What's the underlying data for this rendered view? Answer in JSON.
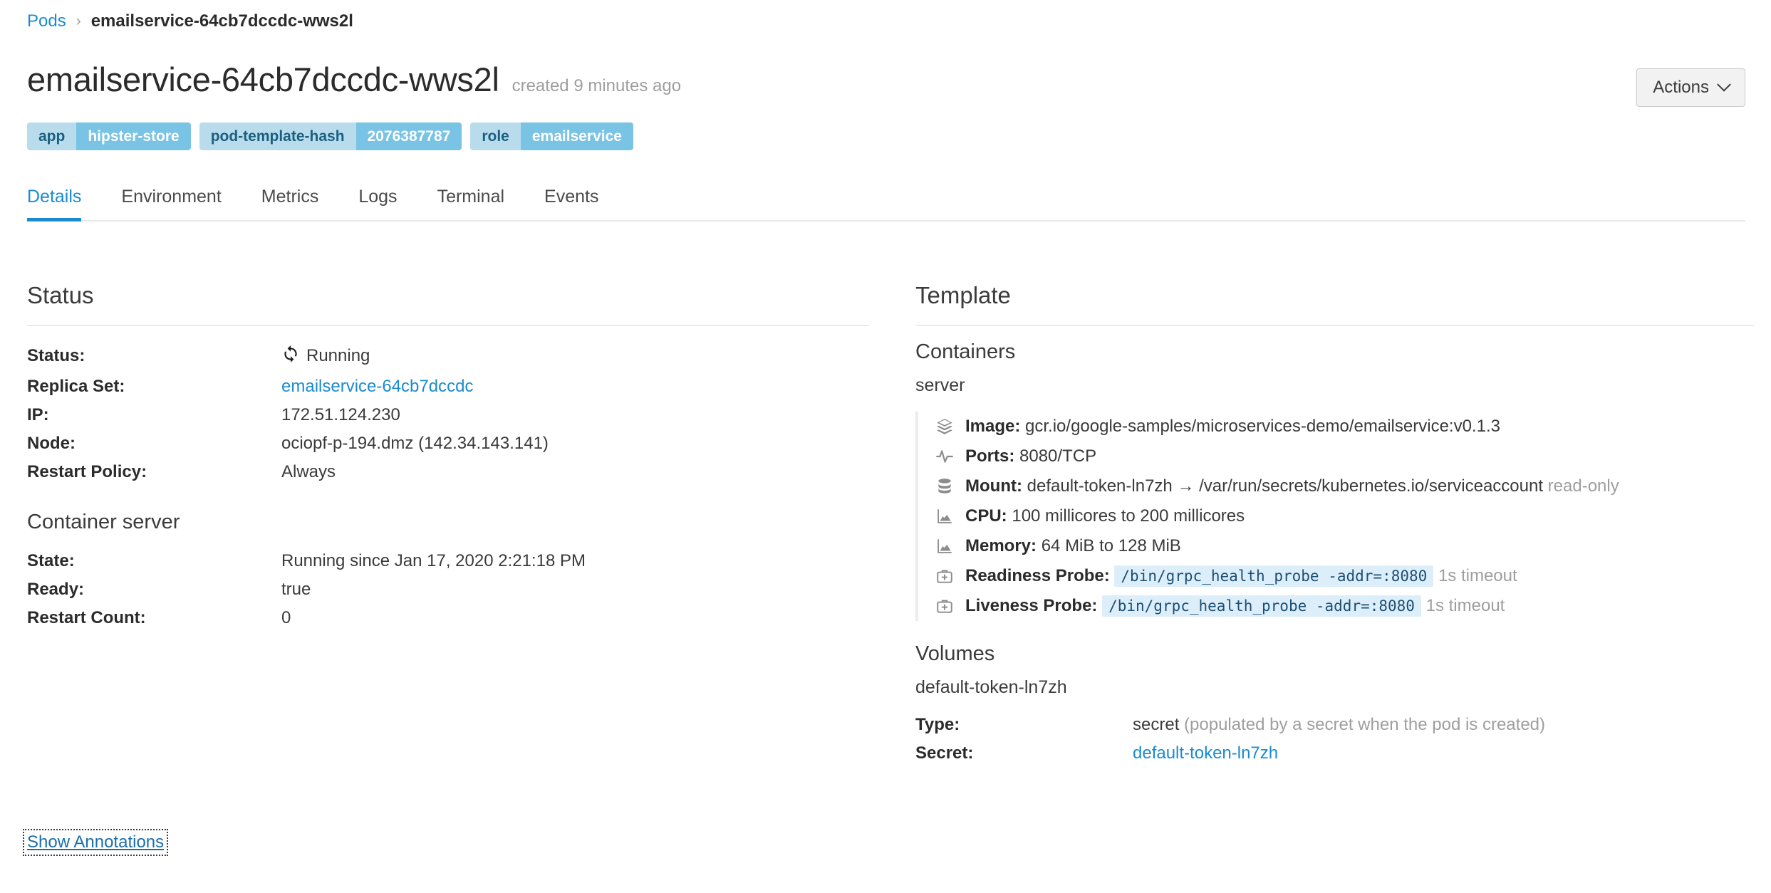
{
  "breadcrumb": {
    "parent": "Pods",
    "separator": "›",
    "current": "emailservice-64cb7dccdc-wws2l"
  },
  "header": {
    "title": "emailservice-64cb7dccdc-wws2l",
    "subtitle": "created 9 minutes ago",
    "actions_label": "Actions",
    "actions_icon": "chevron-down-icon"
  },
  "labels": [
    {
      "key": "app",
      "value": "hipster-store"
    },
    {
      "key": "pod-template-hash",
      "value": "2076387787"
    },
    {
      "key": "role",
      "value": "emailservice"
    }
  ],
  "tabs": [
    {
      "label": "Details",
      "active": true
    },
    {
      "label": "Environment",
      "active": false
    },
    {
      "label": "Metrics",
      "active": false
    },
    {
      "label": "Logs",
      "active": false
    },
    {
      "label": "Terminal",
      "active": false
    },
    {
      "label": "Events",
      "active": false
    }
  ],
  "status_section": {
    "title": "Status",
    "rows": [
      {
        "key": "Status:",
        "value": "Running",
        "icon": "sync-icon",
        "kind": "status"
      },
      {
        "key": "Replica Set:",
        "value": "emailservice-64cb7dccdc",
        "kind": "link"
      },
      {
        "key": "IP:",
        "value": "172.51.124.230",
        "kind": "text"
      },
      {
        "key": "Node:",
        "value": "ociopf-p-194.dmz (142.34.143.141)",
        "kind": "text"
      },
      {
        "key": "Restart Policy:",
        "value": "Always",
        "kind": "text"
      }
    ]
  },
  "container_status": {
    "title": "Container server",
    "rows": [
      {
        "key": "State:",
        "value": "Running since Jan 17, 2020 2:21:18 PM"
      },
      {
        "key": "Ready:",
        "value": "true"
      },
      {
        "key": "Restart Count:",
        "value": "0"
      }
    ]
  },
  "template_section": {
    "title": "Template",
    "containers_title": "Containers",
    "container_name": "server",
    "rows": [
      {
        "icon": "layers-icon",
        "label": "Image:",
        "value": "gcr.io/google-samples/microservices-demo/emailservice:v0.1.3"
      },
      {
        "icon": "pulse-icon",
        "label": "Ports:",
        "value": "8080/TCP"
      },
      {
        "icon": "database-icon",
        "label": "Mount:",
        "value": "default-token-ln7zh → /var/run/secrets/kubernetes.io/serviceaccount",
        "suffix": "read-only"
      },
      {
        "icon": "chart-icon",
        "label": "CPU:",
        "value": "100 millicores to 200 millicores"
      },
      {
        "icon": "chart-icon",
        "label": "Memory:",
        "value": "64 MiB to 128 MiB"
      },
      {
        "icon": "medkit-icon",
        "label": "Readiness Probe:",
        "code": "/bin/grpc_health_probe -addr=:8080",
        "suffix": "1s timeout"
      },
      {
        "icon": "medkit-icon",
        "label": "Liveness Probe:",
        "code": "/bin/grpc_health_probe -addr=:8080",
        "suffix": "1s timeout"
      }
    ],
    "volumes_title": "Volumes",
    "volume_name": "default-token-ln7zh",
    "volume_rows": [
      {
        "key": "Type:",
        "value": "secret",
        "suffix": "(populated by a secret when the pod is created)",
        "kind": "text"
      },
      {
        "key": "Secret:",
        "value": "default-token-ln7zh",
        "kind": "link"
      }
    ]
  },
  "footer": {
    "show_annotations": "Show Annotations"
  },
  "colors": {
    "accent": "#1b8bd0",
    "chip_key_bg": "#b9dced",
    "chip_value_bg": "#79c3e5",
    "code_bg": "#ddeefb",
    "code_fg": "#1c4f73",
    "muted": "#9e9e9e"
  }
}
